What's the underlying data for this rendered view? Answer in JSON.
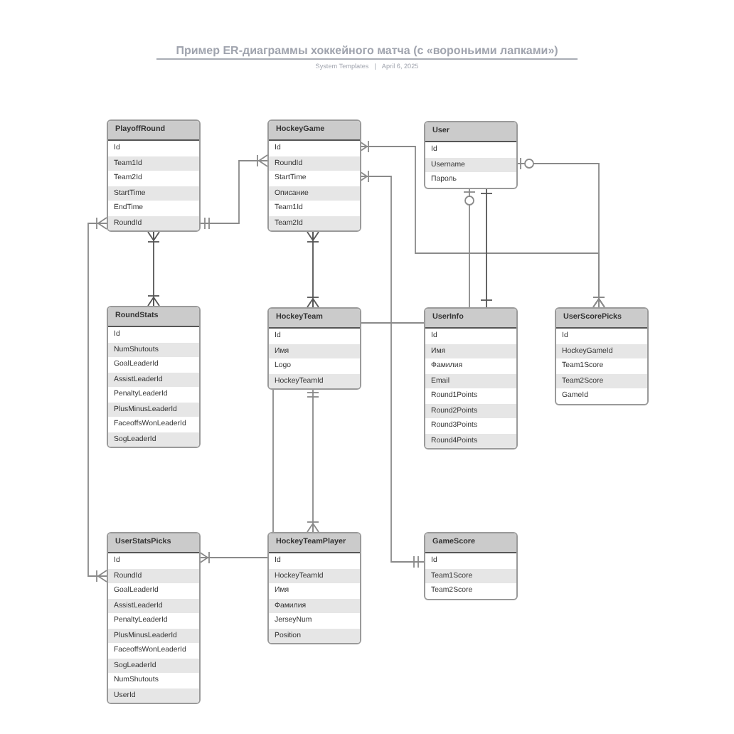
{
  "title": "Пример ER-диаграммы хоккейного матча (с «вороньими лапками»)",
  "subtitle": {
    "author": "System Templates",
    "separator": "|",
    "date": "April 6, 2025"
  },
  "entities": [
    {
      "name": "PlayoffRound",
      "fields": [
        "Id",
        "Team1Id",
        "Team2Id",
        "StartTime",
        "EndTime",
        "RoundId"
      ]
    },
    {
      "name": "HockeyGame",
      "fields": [
        "Id",
        "RoundId",
        "StartTime",
        "Описание",
        "Team1Id",
        "Team2Id"
      ]
    },
    {
      "name": "User",
      "fields": [
        "Id",
        "Username",
        "Пароль"
      ]
    },
    {
      "name": "RoundStats",
      "fields": [
        "Id",
        "NumShutouts",
        "GoalLeaderId",
        "AssistLeaderId",
        "PenaltyLeaderId",
        "PlusMinusLeaderId",
        "FaceoffsWonLeaderId",
        "SogLeaderId"
      ]
    },
    {
      "name": "HockeyTeam",
      "fields": [
        "Id",
        "Имя",
        "Logo",
        "HockeyTeamId"
      ]
    },
    {
      "name": "UserInfo",
      "fields": [
        "Id",
        "Имя",
        "Фамилия",
        "Email",
        "Round1Points",
        "Round2Points",
        "Round3Points",
        "Round4Points"
      ]
    },
    {
      "name": "UserScorePicks",
      "fields": [
        "Id",
        "HockeyGameId",
        "Team1Score",
        "Team2Score",
        "GameId"
      ]
    },
    {
      "name": "UserStatsPicks",
      "fields": [
        "Id",
        "RoundId",
        "GoalLeaderId",
        "AssistLeaderId",
        "PenaltyLeaderId",
        "PlusMinusLeaderId",
        "FaceoffsWonLeaderId",
        "SogLeaderId",
        "NumShutouts",
        "UserId"
      ]
    },
    {
      "name": "HockeyTeamPlayer",
      "fields": [
        "Id",
        "HockeyTeamId",
        "Имя",
        "Фамилия",
        "JerseyNum",
        "Position"
      ]
    },
    {
      "name": "GameScore",
      "fields": [
        "Id",
        "Team1Score",
        "Team2Score"
      ]
    }
  ],
  "relationships": [
    {
      "ends": [
        {
          "kind": "crowfoot"
        },
        {
          "kind": "crowfoot"
        }
      ]
    },
    {
      "ends": [
        {
          "kind": "double"
        },
        {
          "kind": "crowfoot"
        }
      ]
    },
    {
      "ends": [
        {
          "kind": "crowfoot"
        },
        {
          "kind": "crowfoot"
        }
      ]
    },
    {
      "ends": [
        {
          "kind": "crowfoot"
        },
        {
          "kind": "crowfoot"
        }
      ]
    },
    {
      "ends": [
        {
          "kind": "crowfoot"
        },
        {
          "kind": "double"
        }
      ]
    },
    {
      "ends": [
        {
          "kind": "optional"
        },
        {
          "kind": "crowfoot"
        }
      ]
    },
    {
      "ends": [
        {
          "kind": "optional"
        },
        {
          "kind": "plain"
        }
      ]
    },
    {
      "ends": [
        {
          "kind": "single"
        },
        {
          "kind": "single"
        }
      ]
    },
    {
      "ends": [
        {
          "kind": "plain"
        },
        {
          "kind": "plain"
        }
      ]
    },
    {
      "ends": [
        {
          "kind": "double"
        },
        {
          "kind": "crowfoot"
        }
      ]
    },
    {
      "ends": [
        {
          "kind": "plain"
        },
        {
          "kind": "crowfoot"
        }
      ]
    },
    {
      "ends": [
        {
          "kind": "crowfoot"
        },
        {
          "kind": "crowfoot"
        }
      ]
    }
  ]
}
